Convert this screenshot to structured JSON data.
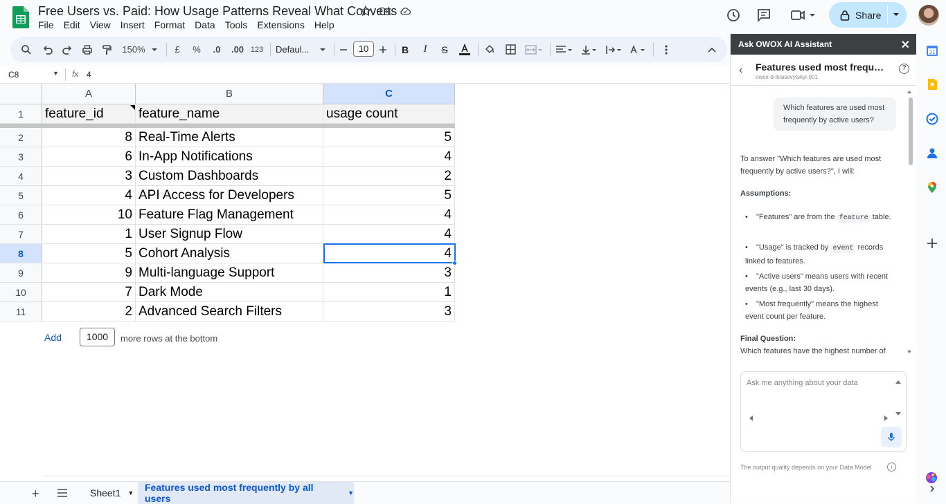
{
  "header": {
    "title": "Free Users vs. Paid: How Usage Patterns Reveal What Converts",
    "menu": [
      "File",
      "Edit",
      "View",
      "Insert",
      "Format",
      "Data",
      "Tools",
      "Extensions",
      "Help"
    ],
    "share_label": "Share"
  },
  "toolbar": {
    "zoom": "150%",
    "currency": "£",
    "percent": "%",
    "dec_decrease": ".0",
    "dec_increase": ".00",
    "format_123": "123",
    "font": "Defaul...",
    "font_size": "10"
  },
  "formula_bar": {
    "name_box": "C8",
    "fx": "fx",
    "value": "4"
  },
  "grid": {
    "columns": [
      "A",
      "B",
      "C"
    ],
    "row_numbers": [
      "1",
      "2",
      "3",
      "4",
      "5",
      "6",
      "7",
      "8",
      "9",
      "10",
      "11"
    ],
    "header_row": [
      "feature_id",
      "feature_name",
      "usage count"
    ],
    "rows": [
      [
        "8",
        "Real-Time Alerts",
        "5"
      ],
      [
        "6",
        "In-App Notifications",
        "4"
      ],
      [
        "3",
        "Custom Dashboards",
        "2"
      ],
      [
        "4",
        "API Access for Developers",
        "5"
      ],
      [
        "10",
        "Feature Flag Management",
        "4"
      ],
      [
        "1",
        "User Signup Flow",
        "4"
      ],
      [
        "5",
        "Cohort Analysis",
        "4"
      ],
      [
        "9",
        "Multi-language Support",
        "3"
      ],
      [
        "7",
        "Dark Mode",
        "1"
      ],
      [
        "2",
        "Advanced Search Filters",
        "3"
      ]
    ],
    "selected_cell": "C8",
    "add_label": "Add",
    "add_rows_value": "1000",
    "add_rows_suffix": "more rows at the bottom"
  },
  "sheets": {
    "tabs": [
      "Sheet1",
      "Features used most frequently by all users"
    ],
    "active": "Features used most frequently by all users"
  },
  "panel": {
    "heading": "Ask OWOX AI Assistant",
    "conversation_title": "Features used most frequent...",
    "conversation_subtitle": "owox-d-ikrasovytskyi-001",
    "user_message": "Which features are used most frequently by active users?",
    "intro": "To answer \"Which features are used most frequently by active users?\", I will:",
    "assumptions_heading": "Assumptions:",
    "a1_pre": "\"Features\" are from the ",
    "a1_code": "feature",
    "a1_post": " table.",
    "a2_pre": "\"Usage\" is tracked by ",
    "a2_code": "event",
    "a2_post": " records linked to features.",
    "a3": "\"Active users\" means users with recent events (e.g., last 30 days).",
    "a4": "\"Most frequently\" means the highest event count per feature.",
    "final_heading": "Final Question:",
    "final_text": "Which features have the highest number of",
    "input_placeholder": "Ask me anything about your data",
    "footer": "The output quality depends on your Data Model"
  },
  "colors": {
    "accent": "#1a73e8",
    "share_bg": "#c2e7ff",
    "panel_header": "#3c4043",
    "selected_header": "#d3e3fd"
  }
}
